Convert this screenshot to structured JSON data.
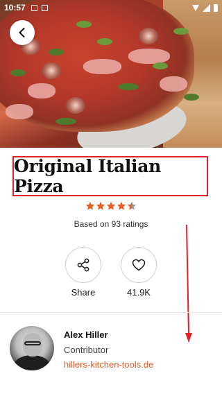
{
  "status_bar": {
    "time": "10:57",
    "icons": [
      "image-icon",
      "notification-icon",
      "wifi-icon",
      "signal-icon",
      "battery-icon"
    ]
  },
  "recipe": {
    "title": "Original Italian Pizza",
    "rating": 4.5,
    "rating_max": 5,
    "ratings_text": "Based on 93 ratings"
  },
  "actions": {
    "share_label": "Share",
    "likes_label": "41.9K"
  },
  "author": {
    "name": "Alex Hiller",
    "role": "Contributor",
    "link": "hillers-kitchen-tools.de"
  },
  "colors": {
    "accent": "#e85d24",
    "annotation_red": "#e0202a",
    "star_filled": "#e85d24",
    "star_empty": "#9a9a9a"
  }
}
